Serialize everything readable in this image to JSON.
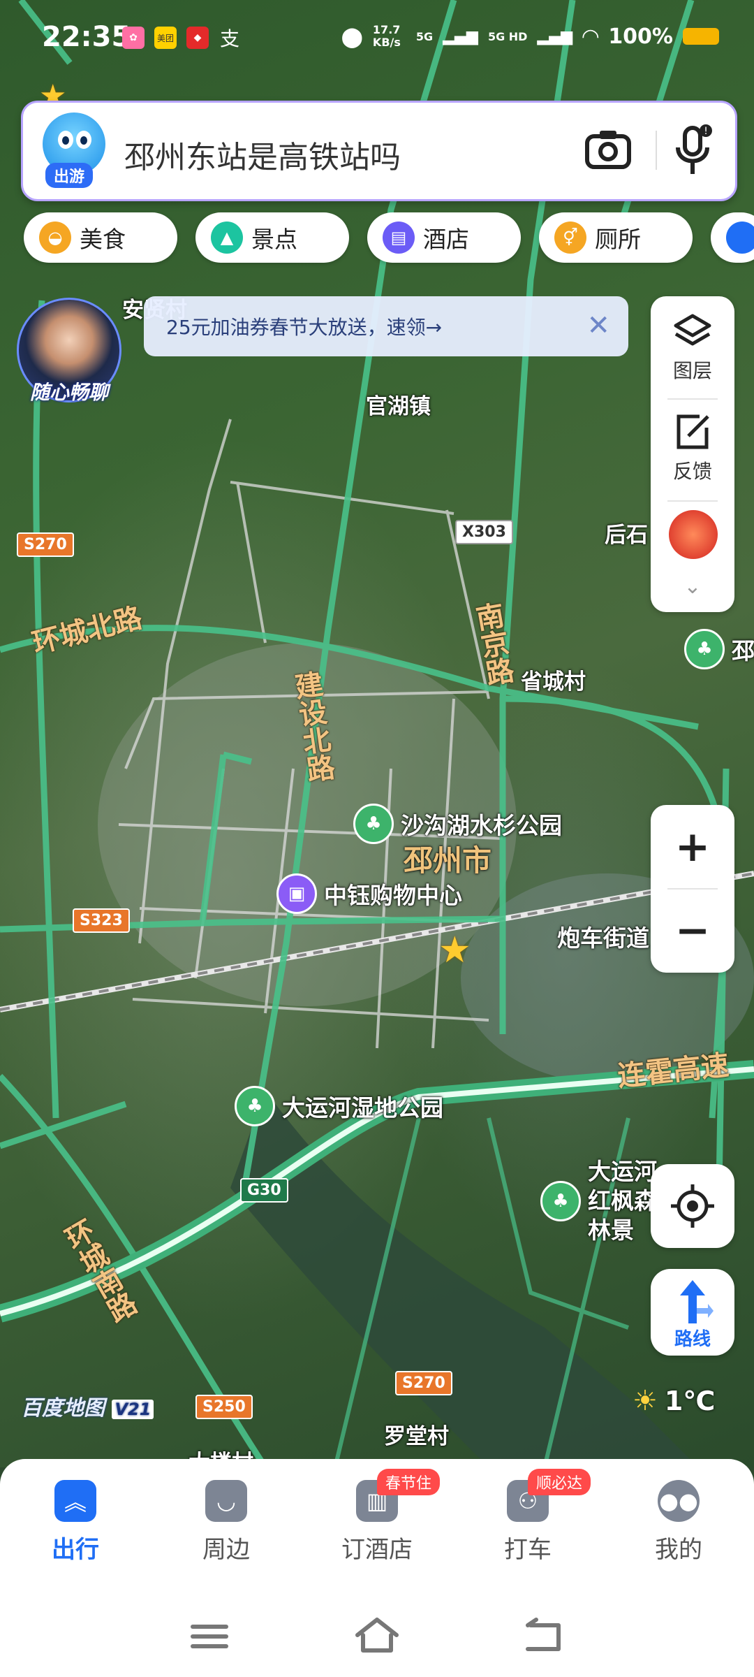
{
  "status_bar": {
    "time": "22:35",
    "net_speed": "17.7 KB/s",
    "signal_1": "5G",
    "signal_2": "5G HD",
    "battery": "100%",
    "app_icons": [
      "app-a",
      "美团",
      "app-b",
      "支"
    ]
  },
  "search": {
    "badge": "出游",
    "query": "邳州东站是高铁站吗",
    "camera_icon": "camera-icon",
    "mic_icon": "mic-icon"
  },
  "categories": [
    {
      "label": "美食",
      "icon": "food-icon",
      "color": "#f5a623"
    },
    {
      "label": "景点",
      "icon": "scenery-icon",
      "color": "#1cc4a0"
    },
    {
      "label": "酒店",
      "icon": "hotel-icon",
      "color": "#6b5cf6"
    },
    {
      "label": "厕所",
      "icon": "toilet-icon",
      "color": "#f5a623"
    }
  ],
  "ai_assistant": {
    "label": "随心畅聊"
  },
  "promo": {
    "text": "25元加油券春节大放送，速领→"
  },
  "tools": {
    "layers": "图层",
    "feedback": "反馈"
  },
  "map": {
    "towns": [
      "安贤村",
      "官湖镇",
      "后石",
      "省城村",
      "罗堂村",
      "大楼村"
    ],
    "city": "邳州市",
    "roads": [
      "环城北路",
      "建设北路",
      "南京路",
      "环城南路",
      "炮车街道",
      "连霍高速"
    ],
    "shields": [
      "S270",
      "X303",
      "S323",
      "G30",
      "S250",
      "S270"
    ],
    "pois": [
      {
        "name": "沙沟湖水杉公园",
        "type": "park"
      },
      {
        "name": "中钰购物中心",
        "type": "shopping"
      },
      {
        "name": "大运河湿地公园",
        "type": "park"
      },
      {
        "name": "大运河红枫森林景",
        "type": "park"
      },
      {
        "name": "邳森",
        "type": "park"
      }
    ],
    "brand": "百度地图",
    "version": "V21"
  },
  "zoom": {
    "in": "+",
    "out": "−"
  },
  "route": {
    "label": "路线"
  },
  "weather": {
    "temp": "1℃"
  },
  "bottom_nav": [
    {
      "label": "出行",
      "active": true
    },
    {
      "label": "周边",
      "active": false
    },
    {
      "label": "订酒店",
      "active": false,
      "tag": "春节住"
    },
    {
      "label": "打车",
      "active": false,
      "tag": "顺必达"
    },
    {
      "label": "我的",
      "active": false
    }
  ]
}
